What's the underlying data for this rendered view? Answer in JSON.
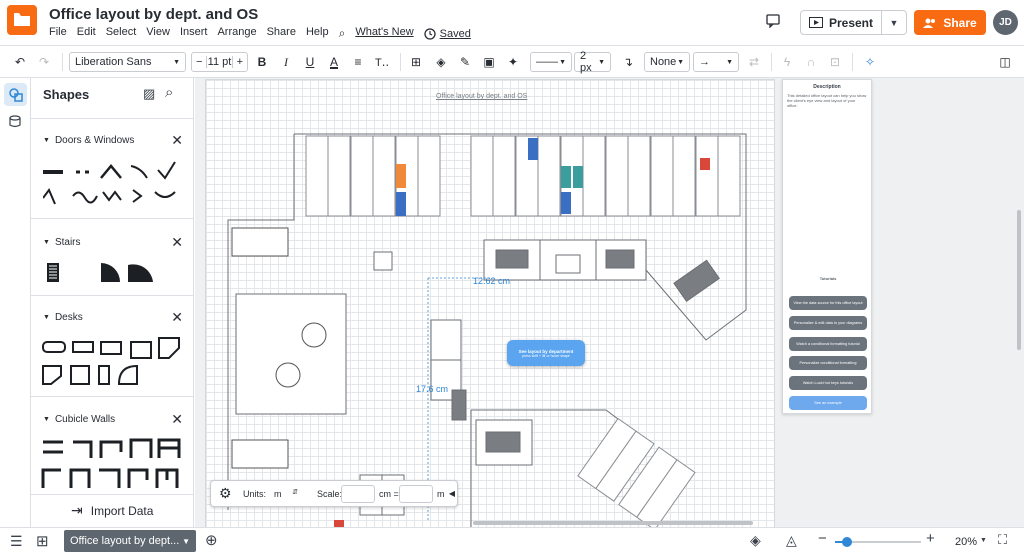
{
  "app": {
    "title": "Office layout by dept. and OS",
    "brand_color": "#f96b13"
  },
  "menu": [
    "File",
    "Edit",
    "Select",
    "View",
    "Insert",
    "Arrange",
    "Share",
    "Help"
  ],
  "menu_links": {
    "whats_new": "What's New",
    "saved": "Saved"
  },
  "header": {
    "present": "Present",
    "share": "Share",
    "avatar": "JD"
  },
  "toolbar": {
    "font": "Liberation Sans",
    "font_size": "11 pt",
    "line_width": "2 px",
    "arrow_start": "None",
    "minus": "−",
    "plus": "+"
  },
  "shapes": {
    "title": "Shapes",
    "sections": [
      {
        "name": "Doors & Windows"
      },
      {
        "name": "Stairs"
      },
      {
        "name": "Desks"
      },
      {
        "name": "Cubicle Walls"
      }
    ],
    "import": "Import Data"
  },
  "canvas": {
    "page_title": "Office layout by dept. and OS",
    "measure_1": "12.62 cm",
    "measure_2": "17.6 cm",
    "floating_btn": "See layout by department",
    "floating_sub": "press shift + ⌘ or hover shape",
    "desc_title": "Description",
    "desc_text": "This detailed office layout can help you show the client's eye view and layout of your office.",
    "tutorials": "Tutorials",
    "desc_buttons": [
      "View the data source for this office layout",
      "Personalize & edit data to your diagrams",
      "Watch a conditional formatting tutorial",
      "Personalize conditional formatting",
      "Watch Lucid hot keys tutorials",
      "See an example"
    ]
  },
  "units": {
    "units_label": "Units:",
    "units_value": "m",
    "scale_label": "Scale:",
    "cm_label": "cm =",
    "m_label": "m"
  },
  "bottom": {
    "page_tab": "Office layout by dept...",
    "zoom": "20%"
  }
}
